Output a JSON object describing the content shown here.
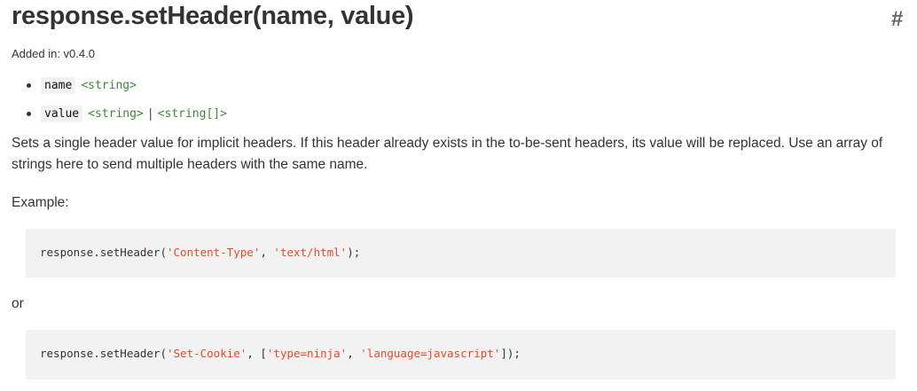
{
  "heading": {
    "title": "response.setHeader(name, value)",
    "anchor": "#"
  },
  "added_in": "Added in: v0.4.0",
  "params": [
    {
      "name": "name",
      "types": [
        "<string>"
      ]
    },
    {
      "name": "value",
      "types": [
        "<string>",
        "<string[]>"
      ],
      "separator": "|"
    }
  ],
  "description": "Sets a single header value for implicit headers. If this header already exists in the to-be-sent headers, its value will be replaced. Use an array of strings here to send multiple headers with the same name.",
  "example_label": "Example:",
  "or_label": "or",
  "examples": [
    {
      "prefix": "response.setHeader(",
      "s1": "'Content-Type'",
      "mid": ", ",
      "s2": "'text/html'",
      "suffix": ");"
    },
    {
      "prefix": "response.setHeader(",
      "s1": "'Set-Cookie'",
      "mid": ", [",
      "s2": "'type=ninja'",
      "mid2": ", ",
      "s3": "'language=javascript'",
      "suffix": "]);"
    }
  ],
  "colors": {
    "type_link": "#43853d",
    "string": "#e34c26",
    "code_bg": "#f2f2f2"
  }
}
